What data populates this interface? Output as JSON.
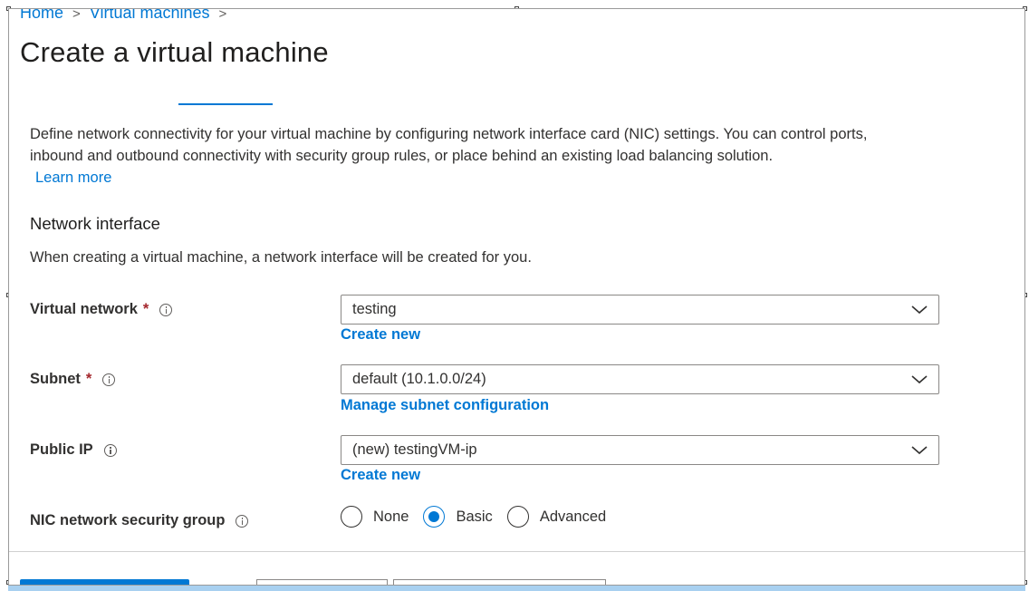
{
  "breadcrumb": {
    "home": "Home",
    "vms": "Virtual machines",
    "sep": ">"
  },
  "page": {
    "title": "Create a virtual machine"
  },
  "description": {
    "text": "Define network connectivity for your virtual machine by configuring network interface card (NIC) settings. You can control ports, inbound and outbound connectivity with security group rules, or place behind an existing load balancing solution.",
    "learn_more": "Learn more"
  },
  "network_interface": {
    "title": "Network interface",
    "subtitle": "When creating a virtual machine, a network interface will be created for you."
  },
  "fields": {
    "virtual_network": {
      "label": "Virtual network",
      "required": "*",
      "value": "testing",
      "link": "Create new"
    },
    "subnet": {
      "label": "Subnet",
      "required": "*",
      "value": "default (10.1.0.0/24)",
      "link": "Manage subnet configuration"
    },
    "public_ip": {
      "label": "Public IP",
      "value": "(new) testingVM-ip",
      "link": "Create new"
    },
    "nic_nsg": {
      "label": "NIC network security group",
      "options": [
        "None",
        "Basic",
        "Advanced"
      ],
      "selected": "Basic"
    }
  },
  "colors": {
    "accent": "#0078d4",
    "required": "#a4262c",
    "text": "#323130"
  }
}
